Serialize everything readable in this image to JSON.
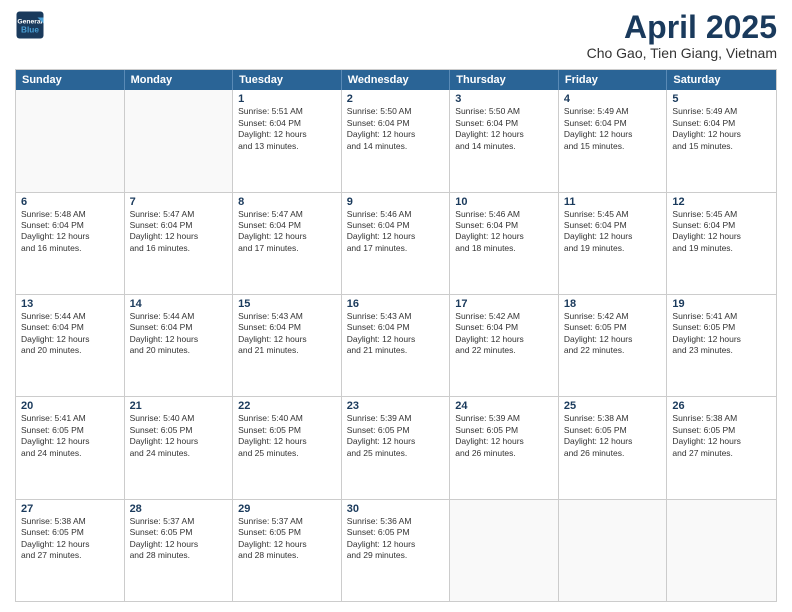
{
  "header": {
    "logo_line1": "General",
    "logo_line2": "Blue",
    "month": "April 2025",
    "location": "Cho Gao, Tien Giang, Vietnam"
  },
  "days_of_week": [
    "Sunday",
    "Monday",
    "Tuesday",
    "Wednesday",
    "Thursday",
    "Friday",
    "Saturday"
  ],
  "weeks": [
    [
      {
        "day": "",
        "info": "",
        "empty": true
      },
      {
        "day": "",
        "info": "",
        "empty": true
      },
      {
        "day": "1",
        "info": "Sunrise: 5:51 AM\nSunset: 6:04 PM\nDaylight: 12 hours\nand 13 minutes."
      },
      {
        "day": "2",
        "info": "Sunrise: 5:50 AM\nSunset: 6:04 PM\nDaylight: 12 hours\nand 14 minutes."
      },
      {
        "day": "3",
        "info": "Sunrise: 5:50 AM\nSunset: 6:04 PM\nDaylight: 12 hours\nand 14 minutes."
      },
      {
        "day": "4",
        "info": "Sunrise: 5:49 AM\nSunset: 6:04 PM\nDaylight: 12 hours\nand 15 minutes."
      },
      {
        "day": "5",
        "info": "Sunrise: 5:49 AM\nSunset: 6:04 PM\nDaylight: 12 hours\nand 15 minutes."
      }
    ],
    [
      {
        "day": "6",
        "info": "Sunrise: 5:48 AM\nSunset: 6:04 PM\nDaylight: 12 hours\nand 16 minutes."
      },
      {
        "day": "7",
        "info": "Sunrise: 5:47 AM\nSunset: 6:04 PM\nDaylight: 12 hours\nand 16 minutes."
      },
      {
        "day": "8",
        "info": "Sunrise: 5:47 AM\nSunset: 6:04 PM\nDaylight: 12 hours\nand 17 minutes."
      },
      {
        "day": "9",
        "info": "Sunrise: 5:46 AM\nSunset: 6:04 PM\nDaylight: 12 hours\nand 17 minutes."
      },
      {
        "day": "10",
        "info": "Sunrise: 5:46 AM\nSunset: 6:04 PM\nDaylight: 12 hours\nand 18 minutes."
      },
      {
        "day": "11",
        "info": "Sunrise: 5:45 AM\nSunset: 6:04 PM\nDaylight: 12 hours\nand 19 minutes."
      },
      {
        "day": "12",
        "info": "Sunrise: 5:45 AM\nSunset: 6:04 PM\nDaylight: 12 hours\nand 19 minutes."
      }
    ],
    [
      {
        "day": "13",
        "info": "Sunrise: 5:44 AM\nSunset: 6:04 PM\nDaylight: 12 hours\nand 20 minutes."
      },
      {
        "day": "14",
        "info": "Sunrise: 5:44 AM\nSunset: 6:04 PM\nDaylight: 12 hours\nand 20 minutes."
      },
      {
        "day": "15",
        "info": "Sunrise: 5:43 AM\nSunset: 6:04 PM\nDaylight: 12 hours\nand 21 minutes."
      },
      {
        "day": "16",
        "info": "Sunrise: 5:43 AM\nSunset: 6:04 PM\nDaylight: 12 hours\nand 21 minutes."
      },
      {
        "day": "17",
        "info": "Sunrise: 5:42 AM\nSunset: 6:04 PM\nDaylight: 12 hours\nand 22 minutes."
      },
      {
        "day": "18",
        "info": "Sunrise: 5:42 AM\nSunset: 6:05 PM\nDaylight: 12 hours\nand 22 minutes."
      },
      {
        "day": "19",
        "info": "Sunrise: 5:41 AM\nSunset: 6:05 PM\nDaylight: 12 hours\nand 23 minutes."
      }
    ],
    [
      {
        "day": "20",
        "info": "Sunrise: 5:41 AM\nSunset: 6:05 PM\nDaylight: 12 hours\nand 24 minutes."
      },
      {
        "day": "21",
        "info": "Sunrise: 5:40 AM\nSunset: 6:05 PM\nDaylight: 12 hours\nand 24 minutes."
      },
      {
        "day": "22",
        "info": "Sunrise: 5:40 AM\nSunset: 6:05 PM\nDaylight: 12 hours\nand 25 minutes."
      },
      {
        "day": "23",
        "info": "Sunrise: 5:39 AM\nSunset: 6:05 PM\nDaylight: 12 hours\nand 25 minutes."
      },
      {
        "day": "24",
        "info": "Sunrise: 5:39 AM\nSunset: 6:05 PM\nDaylight: 12 hours\nand 26 minutes."
      },
      {
        "day": "25",
        "info": "Sunrise: 5:38 AM\nSunset: 6:05 PM\nDaylight: 12 hours\nand 26 minutes."
      },
      {
        "day": "26",
        "info": "Sunrise: 5:38 AM\nSunset: 6:05 PM\nDaylight: 12 hours\nand 27 minutes."
      }
    ],
    [
      {
        "day": "27",
        "info": "Sunrise: 5:38 AM\nSunset: 6:05 PM\nDaylight: 12 hours\nand 27 minutes."
      },
      {
        "day": "28",
        "info": "Sunrise: 5:37 AM\nSunset: 6:05 PM\nDaylight: 12 hours\nand 28 minutes."
      },
      {
        "day": "29",
        "info": "Sunrise: 5:37 AM\nSunset: 6:05 PM\nDaylight: 12 hours\nand 28 minutes."
      },
      {
        "day": "30",
        "info": "Sunrise: 5:36 AM\nSunset: 6:05 PM\nDaylight: 12 hours\nand 29 minutes."
      },
      {
        "day": "",
        "info": "",
        "empty": true
      },
      {
        "day": "",
        "info": "",
        "empty": true
      },
      {
        "day": "",
        "info": "",
        "empty": true
      }
    ]
  ]
}
